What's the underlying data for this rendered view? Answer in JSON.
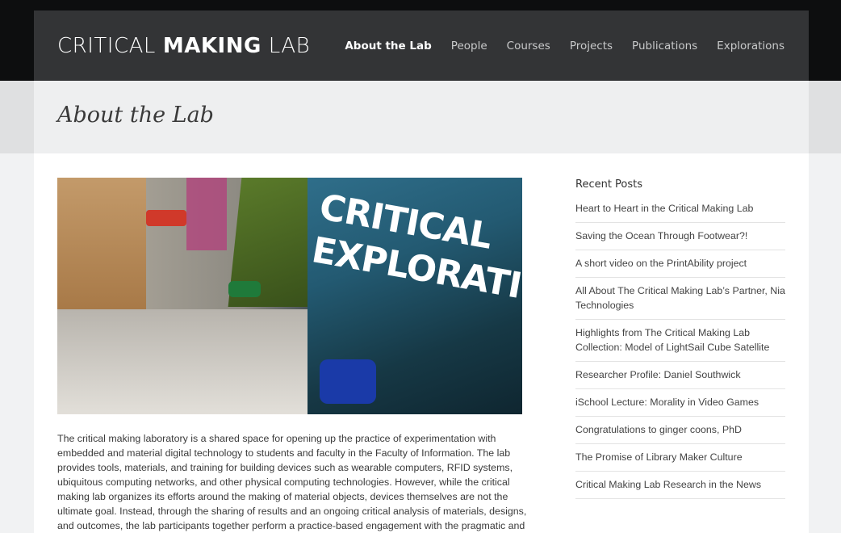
{
  "site": {
    "logo_part1": "CRITICAL",
    "logo_part2": "MAKING",
    "logo_part3": "LAB"
  },
  "nav": {
    "items": [
      {
        "label": "About the Lab",
        "active": true
      },
      {
        "label": "People"
      },
      {
        "label": "Courses"
      },
      {
        "label": "Projects"
      },
      {
        "label": "Publications"
      },
      {
        "label": "Explorations"
      }
    ]
  },
  "page": {
    "title": "About the Lab"
  },
  "hero": {
    "text_line1": "CRITICAL",
    "text_line2": "EXPLORATION"
  },
  "main": {
    "body": "The critical making laboratory is a shared space for opening up the practice of experimentation with embedded and material digital technology to students and faculty in the Faculty of Information. The lab provides tools, materials, and training for building devices such as wearable computers, RFID systems, ubiquitous computing networks, and other physical computing technologies. However, while the critical making lab organizes its efforts around the making of material objects, devices themselves are not the ultimate goal. Instead, through the sharing of results and an ongoing critical analysis of materials, designs, and outcomes, the lab participants together perform a practice-based engagement with the pragmatic and theoretical issues around information"
  },
  "sidebar": {
    "heading": "Recent Posts",
    "posts": [
      "Heart to Heart in the Critical Making Lab",
      "Saving the Ocean Through Footwear?!",
      "A short video on the PrintAbility project",
      "All About The Critical Making Lab’s Partner, Nia Technologies",
      "Highlights from The Critical Making Lab Collection: Model of LightSail Cube Satellite",
      "Researcher Profile: Daniel Southwick",
      "iSchool Lecture: Morality in Video Games",
      "Congratulations to ginger coons, PhD",
      "The Promise of Library Maker Culture",
      "Critical Making Lab Research in the News"
    ]
  },
  "colors": {
    "header_bg": "#333436",
    "page_bg": "#0d0e0f",
    "title_bar_bg": "#eeeff0",
    "nav_active": "#ffffff",
    "nav_inactive": "#c9cacb"
  }
}
